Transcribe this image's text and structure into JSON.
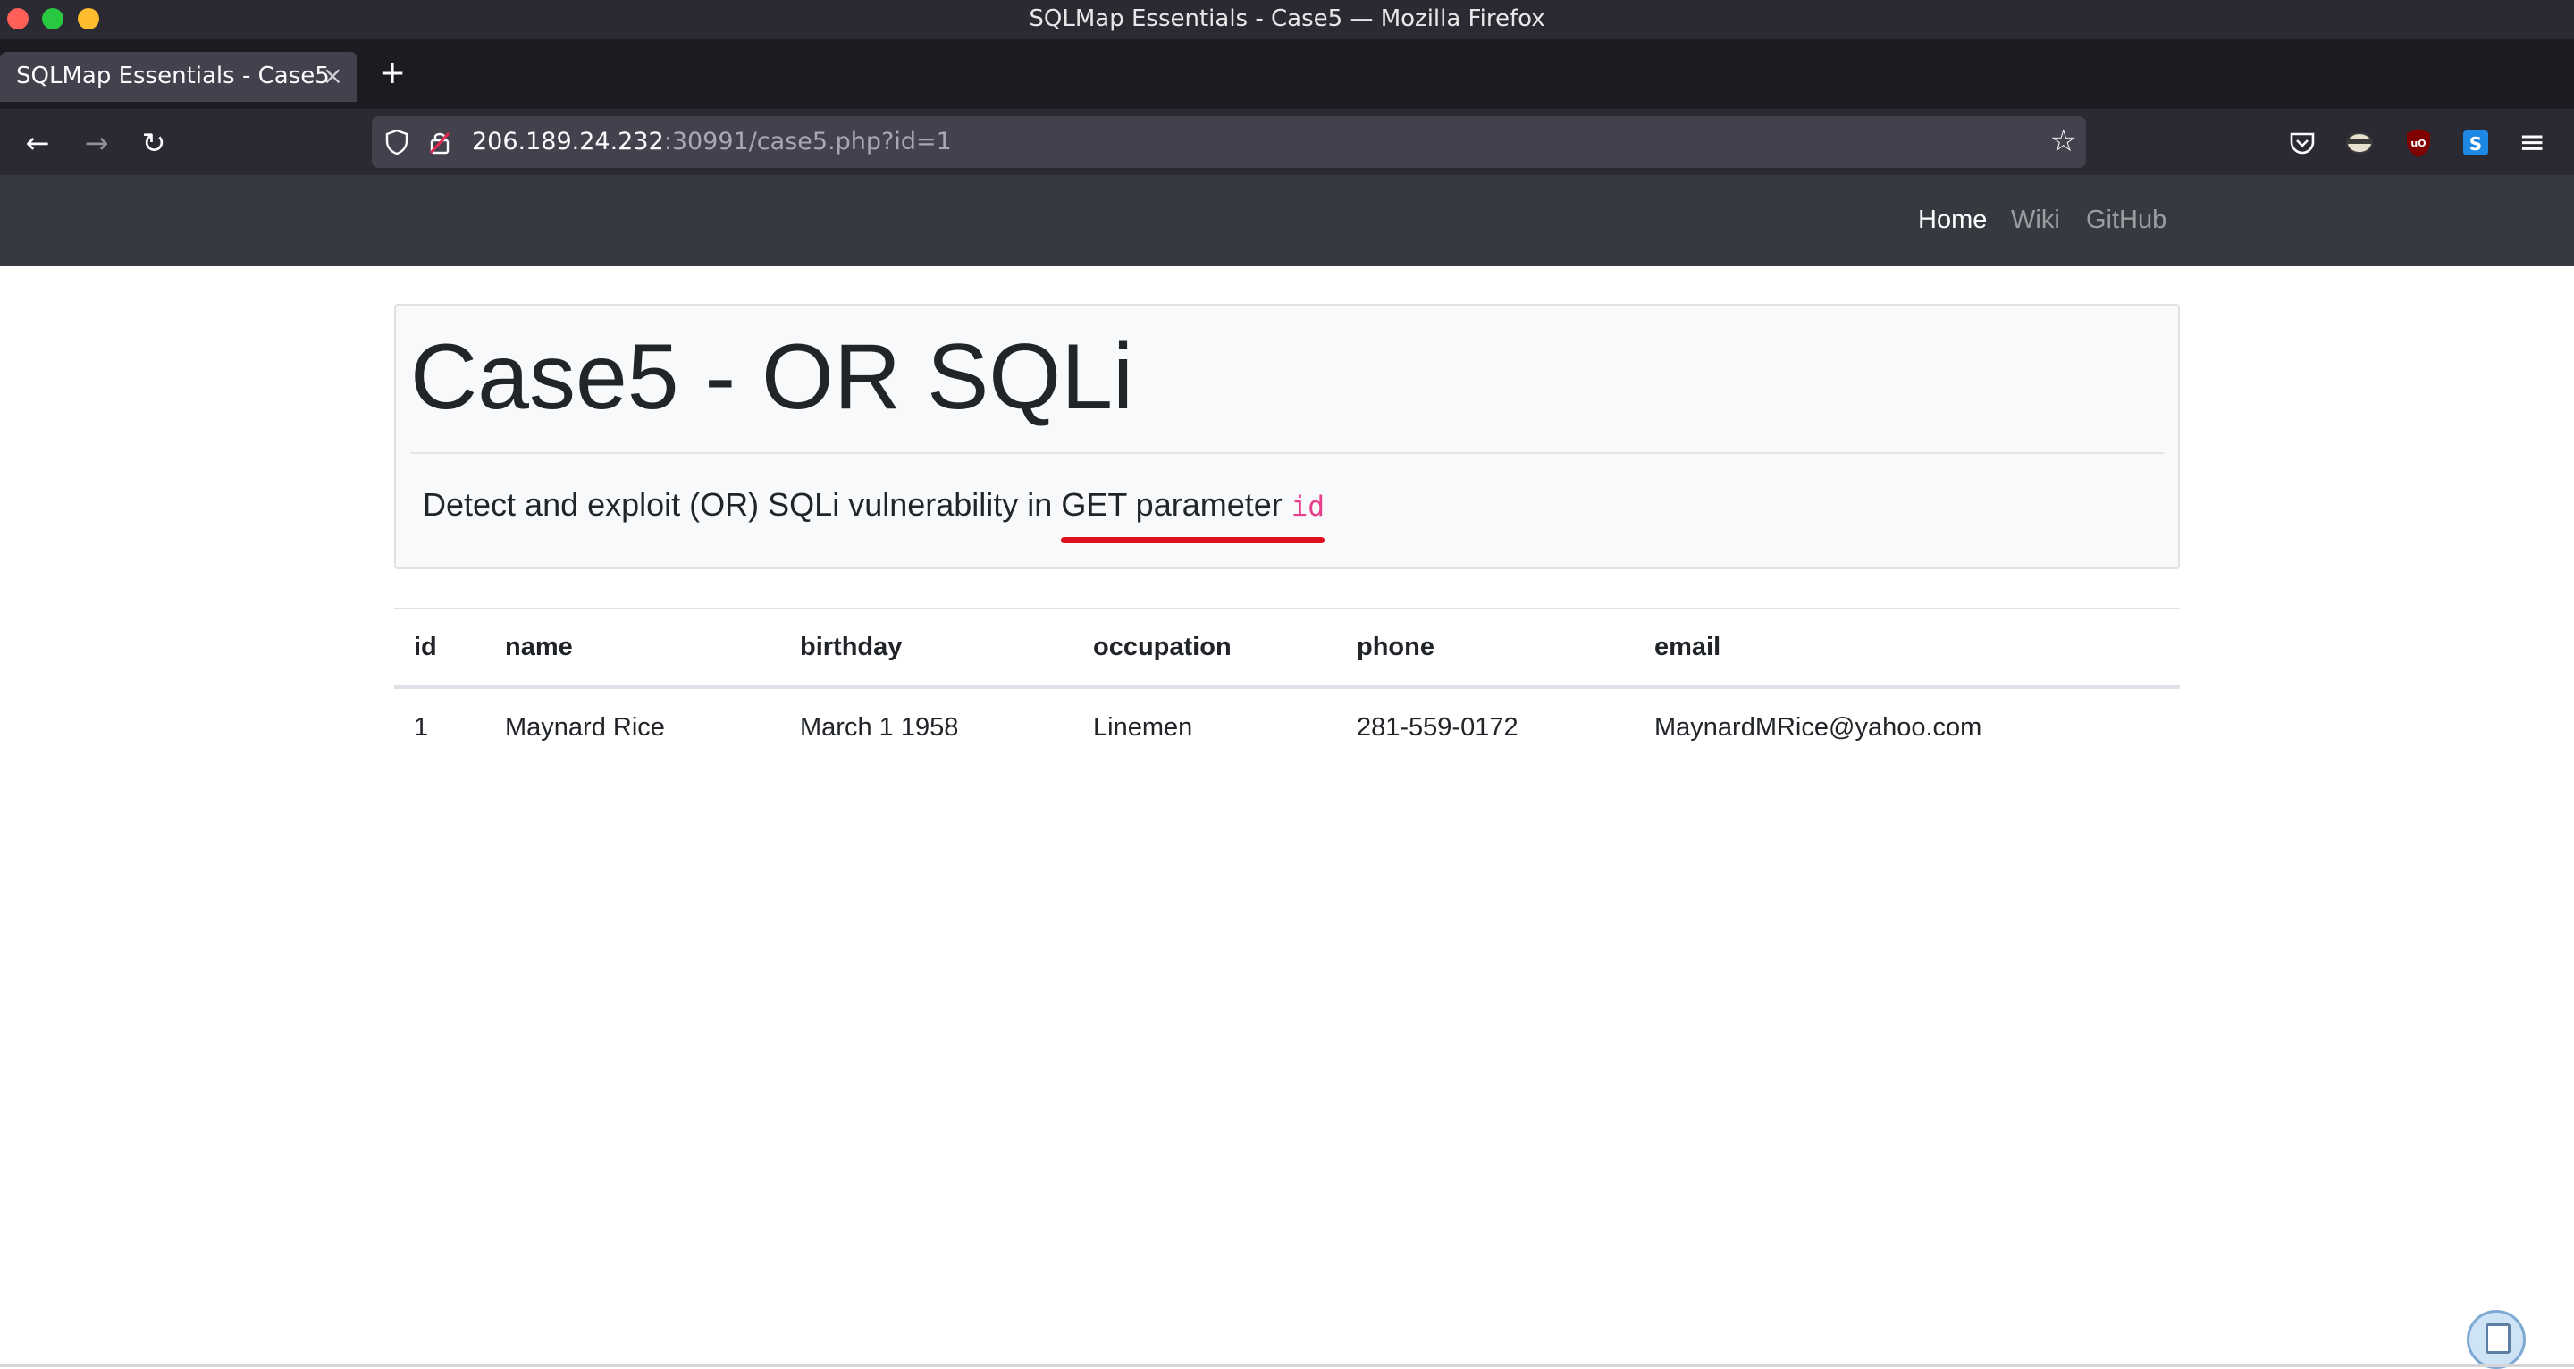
{
  "window": {
    "title": "SQLMap Essentials - Case5 — Mozilla Firefox"
  },
  "tabs": [
    {
      "label": "SQLMap Essentials - Case5",
      "close": "×"
    }
  ],
  "toolbar": {
    "new_tab": "+",
    "back": "←",
    "forward": "→",
    "reload": "↻",
    "menu": "≡",
    "bookmark_star": "☆"
  },
  "urlbar": {
    "host": "206.189.24.232",
    "path": ":30991/case5.php?id=1"
  },
  "site_nav": {
    "items": [
      {
        "label": "Home",
        "active": true
      },
      {
        "label": "Wiki",
        "active": false
      },
      {
        "label": "GitHub",
        "active": false
      }
    ]
  },
  "jumbotron": {
    "title": "Case5 - OR SQLi",
    "lead_prefix": "Detect and exploit (OR) SQLi vulnerability in ",
    "lead_highlight": "GET parameter ",
    "lead_code": "id"
  },
  "table": {
    "headers": [
      "id",
      "name",
      "birthday",
      "occupation",
      "phone",
      "email"
    ],
    "rows": [
      [
        "1",
        "Maynard Rice",
        "March 1 1958",
        "Linemen",
        "281-559-0172",
        "MaynardMRice@yahoo.com"
      ]
    ]
  },
  "colors": {
    "chrome_dark": "#2b2a33",
    "tabstrip": "#1c1b22",
    "site_nav": "#343a40",
    "code_pink": "#e83e8c",
    "annotation_red": "#e0101a"
  },
  "icons": [
    "shield-icon",
    "lock-icon",
    "star-icon",
    "pocket-icon",
    "ninja-extension-icon",
    "ublock-icon",
    "s-extension-icon",
    "hamburger-menu-icon",
    "clipboard-icon"
  ]
}
